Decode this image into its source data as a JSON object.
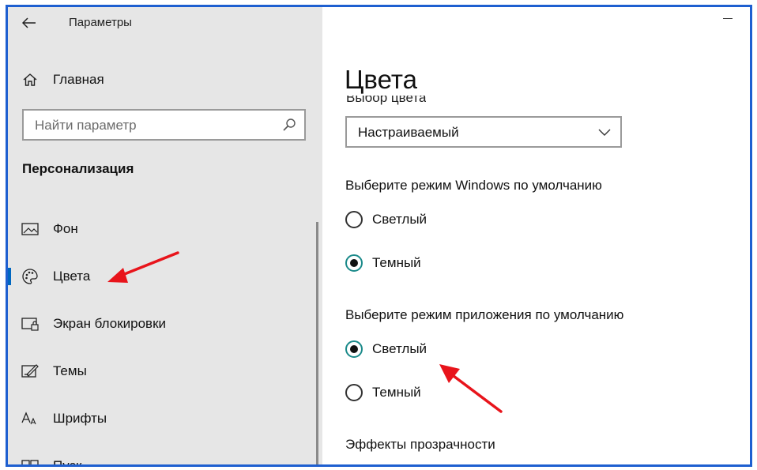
{
  "window": {
    "title": "Параметры"
  },
  "sidebar": {
    "home_label": "Главная",
    "search": {
      "placeholder": "Найти параметр"
    },
    "section_title": "Персонализация",
    "items": [
      {
        "label": "Фон",
        "icon": "picture-icon"
      },
      {
        "label": "Цвета",
        "icon": "palette-icon",
        "active": true
      },
      {
        "label": "Экран блокировки",
        "icon": "lock-screen-icon"
      },
      {
        "label": "Темы",
        "icon": "themes-icon"
      },
      {
        "label": "Шрифты",
        "icon": "fonts-icon"
      },
      {
        "label": "Пуск",
        "icon": "start-icon"
      }
    ]
  },
  "main": {
    "title": "Цвета",
    "color_choice_label": "Выбор цвета",
    "color_select_value": "Настраиваемый",
    "windows_mode": {
      "label": "Выберите режим Windows по умолчанию",
      "options": [
        "Светлый",
        "Темный"
      ],
      "selected": "Темный"
    },
    "app_mode": {
      "label": "Выберите режим приложения по умолчанию",
      "options": [
        "Светлый",
        "Темный"
      ],
      "selected": "Светлый"
    },
    "transparency_label": "Эффекты прозрачности"
  },
  "colors": {
    "accent": "#0067c0",
    "frame": "#1e5fd0",
    "annotation_arrow": "#e8141b",
    "radio_selected_ring": "#1b8a8a"
  }
}
